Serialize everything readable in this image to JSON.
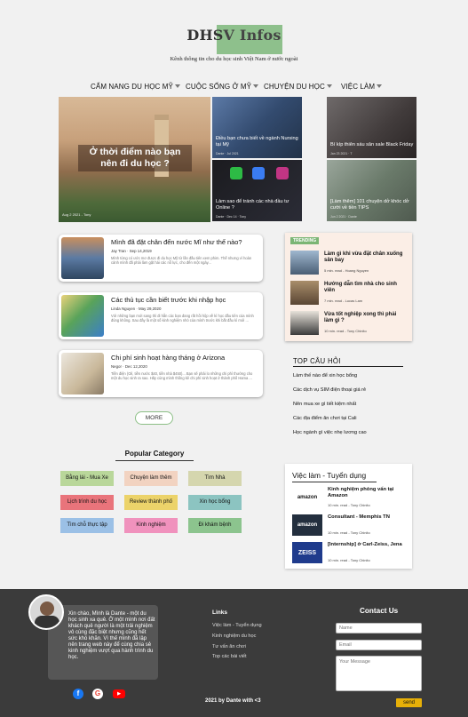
{
  "header": {
    "brand_prefix": "DHS",
    "brand_rest": "V Infos",
    "tagline": "Kênh thông tin cho du học sinh Việt Nam ở nước ngoài"
  },
  "nav": [
    {
      "label": "CẨM NANG DU HỌC MỸ"
    },
    {
      "label": "CUỘC SỐNG Ở MỸ"
    },
    {
      "label": "CHUYỆN DU HỌC"
    },
    {
      "label": "VIỆC LÀM"
    }
  ],
  "hero": {
    "main": {
      "title": "Ở thời điểm nào bạn nên đi du học ?",
      "meta": "Aug 2 2021 - Tony"
    },
    "items": [
      {
        "title": "Điều bạn chưa biết về ngành Nursing tại Mỹ",
        "meta": "Dante · Jul 2021"
      },
      {
        "title": "Bí kíp thiên sáu săn sale Black Friday",
        "meta": "Jan 23 2021 · T"
      },
      {
        "title": "Làm sao để tránh các nhà đầu tư Online ?",
        "meta": "Dante · Dec 14 · Tony"
      },
      {
        "title": "[Làm thêm] 101 chuyện dở khóc dở cười về tiền TIPS",
        "meta": "Jun 2 2021 · Dante"
      }
    ]
  },
  "articles": [
    {
      "title": "Mình đã đặt chân đến nước Mĩ như thế nào?",
      "meta": "Jay Tran  ·  Sep 14,2019",
      "excerpt": "Mình từng có ước mơ được đi du học Mỹ từ lần đầu tiên xem phim. Thế nhưng vì hoàn cảnh mình đã phải làm gặt hái các nỗ lực, cho đến một ngày..."
    },
    {
      "title": "Các thủ tục cần biết trước khi nhập học",
      "meta": "Linda Nguyen  ·  May 29,2020",
      "excerpt": "Với những bạn mới sang thì đi hẳn các bạn đang rất hồi hộp về kì học đầu tiên của mình đúng không. Sau đây là một số kinh nghiệm nhỏ của mình trước khi bắt đầu kì mới ..."
    },
    {
      "title": "Chi phí sinh hoạt hàng tháng ở Arizona",
      "meta": "Negor  ·  Dec 12,2020",
      "excerpt": "Tiền điện (Oil, tiền nước $40, tiền nhà $450)... Bạn sẽ phải lo những chi phí thường cho một du học sinh ra sao. Hãy cùng mình thống kê chi phí sinh hoạt ở thành phố Hama ..."
    }
  ],
  "more_label": "MORE",
  "popular": {
    "title": "Popular Category",
    "tags": [
      {
        "label": "Bằng lái - Mua Xe",
        "color": "#b9d79a"
      },
      {
        "label": "Chuyện làm thêm",
        "color": "#f2d3c1"
      },
      {
        "label": "Tìm Nhà",
        "color": "#d5d6ae"
      },
      {
        "label": "Lịch trình du học",
        "color": "#e9747b"
      },
      {
        "label": "Review thành phố",
        "color": "#ecd36a"
      },
      {
        "label": "Xin học bổng",
        "color": "#8cc4c1"
      },
      {
        "label": "Tìm chỗ thực tập",
        "color": "#9bc0e6"
      },
      {
        "label": "Kinh nghiệm",
        "color": "#f092bd"
      },
      {
        "label": "Đi khám bệnh",
        "color": "#8cc48e"
      }
    ]
  },
  "trending": {
    "label": "TRENDING",
    "items": [
      {
        "title": "Làm gì khi vừa đặt chân xuống sân bay",
        "meta": "5 min. read - Hoang Nguyen"
      },
      {
        "title": "Hướng dẫn tìm nhà cho sinh viên",
        "meta": "7 min. read - Lucas Lam"
      },
      {
        "title": "Vừa tốt nghiệp xong thì phải làm gì ?",
        "meta": "10 min. read - Tony Chinito"
      }
    ]
  },
  "top_questions": {
    "title": "TOP CÂU HỎI",
    "items": [
      "Làm thế nào để xin học bổng",
      "Các dịch vụ SIM điện thoại giá rẻ",
      "Nên mua xe gì tiết kiệm nhất",
      "Các địa điểm ăn chơi tại Cali",
      "Học ngành gì việc nhẹ lương cao"
    ]
  },
  "jobs": {
    "title": "Việc làm - Tuyển dụng",
    "items": [
      {
        "title": "Kinh nghiệm phỏng vấn tại Amazon",
        "meta": "10 min. read - Tony Chinito",
        "logo": "amazon"
      },
      {
        "title": "Consultant - Memphis TN",
        "meta": "10 min. read - Tony Chinito",
        "logo": "amazon"
      },
      {
        "title": "[Internship] ở Carl-Zeiss, Jena",
        "meta": "10 min. read - Tony Chinito",
        "logo": "ZEISS"
      }
    ]
  },
  "footer": {
    "bio": "Xin chào, Mình là Dante - một du học sinh xa quê. Ở một mình nơi đất khách quê người là một trải nghiệm vô cùng đặc biệt nhưng cũng hết sức khó khăn. Vì thế mình đã lập nên trang web này để cùng chia sẻ kinh nghiệm vượt qua hành trình du học.",
    "links_title": "Links",
    "links": [
      "Việc làm - Tuyển dụng",
      "Kinh nghiệm du học",
      "Tư vấn ăn chơi",
      "Top các bài viết"
    ],
    "contact_title": "Contact Us",
    "name_placeholder": "Name",
    "email_placeholder": "Email",
    "message_placeholder": "Your Message",
    "send_label": "send",
    "copyright": "2021 by Dante with  <3",
    "social": [
      {
        "icon": "facebook-icon",
        "glyph": "f"
      },
      {
        "icon": "google-icon",
        "glyph": "G"
      },
      {
        "icon": "youtube-icon",
        "glyph": "▶"
      }
    ]
  }
}
